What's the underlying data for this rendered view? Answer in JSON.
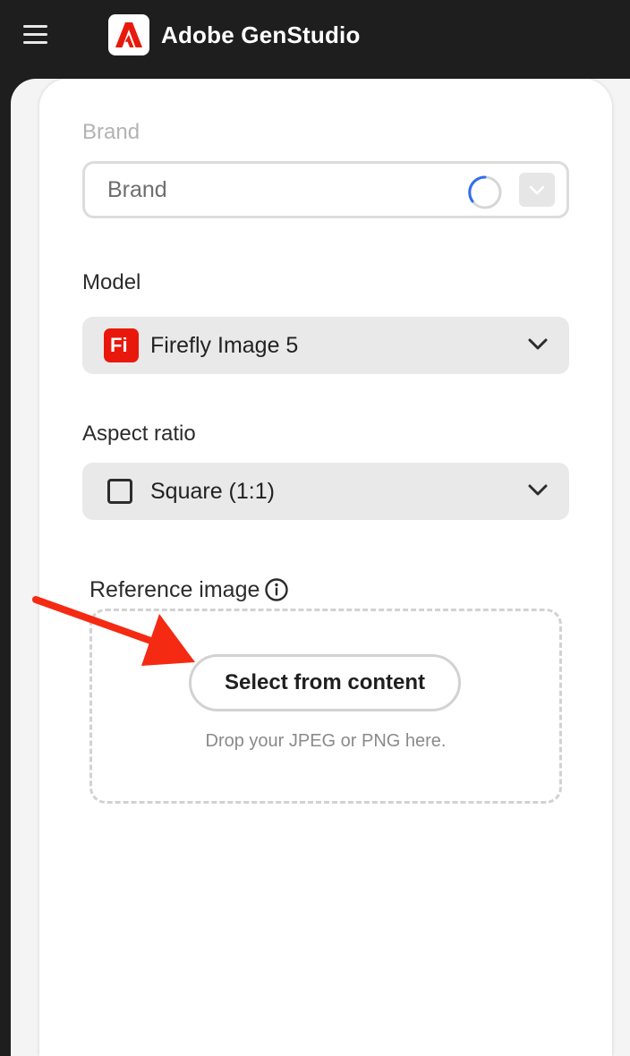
{
  "header": {
    "app_title": "Adobe GenStudio",
    "menu_icon": "hamburger-menu-icon",
    "logo_icon": "adobe-logo-icon",
    "logo_color": "#e8190c"
  },
  "form": {
    "brand": {
      "label": "Brand",
      "value": "Brand",
      "state": "loading",
      "icons": [
        "loading-spinner-icon",
        "chevron-down-icon"
      ]
    },
    "model": {
      "label": "Model",
      "value": "Firefly Image 5",
      "icon_text": "Fi",
      "icon_color": "#e8190c"
    },
    "aspect_ratio": {
      "label": "Aspect ratio",
      "value": "Square (1:1)",
      "icon": "square-icon"
    },
    "reference_image": {
      "label": "Reference image",
      "info_icon": "info-icon",
      "button_label": "Select from content",
      "hint": "Drop your JPEG or PNG here."
    }
  },
  "annotation": {
    "arrow_color": "#f52a12"
  }
}
